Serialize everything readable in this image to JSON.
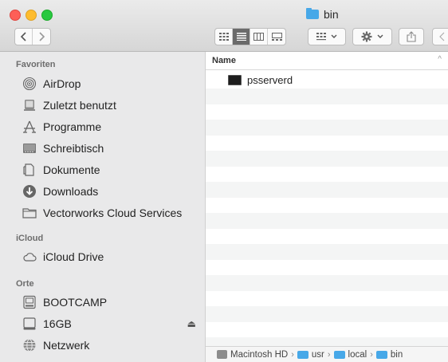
{
  "window": {
    "title": "bin"
  },
  "toolbar": {
    "back_icon": "chevron-left-icon",
    "forward_icon": "chevron-right-icon",
    "view_modes": [
      "icon-view",
      "list-view",
      "column-view",
      "gallery-view"
    ],
    "active_view": "list-view"
  },
  "sidebar": {
    "favorites_header": "Favoriten",
    "favorites": [
      {
        "label": "AirDrop",
        "icon": "airdrop-icon"
      },
      {
        "label": "Zuletzt benutzt",
        "icon": "recents-icon"
      },
      {
        "label": "Programme",
        "icon": "applications-icon"
      },
      {
        "label": "Schreibtisch",
        "icon": "desktop-icon"
      },
      {
        "label": "Dokumente",
        "icon": "documents-icon"
      },
      {
        "label": "Downloads",
        "icon": "downloads-icon"
      },
      {
        "label": "Vectorworks Cloud Services",
        "icon": "folder-icon"
      }
    ],
    "icloud_header": "iCloud",
    "icloud": [
      {
        "label": "iCloud Drive",
        "icon": "cloud-icon"
      }
    ],
    "locations_header": "Orte",
    "locations": [
      {
        "label": "BOOTCAMP",
        "icon": "disk-icon"
      },
      {
        "label": "16GB",
        "icon": "drive-icon",
        "eject": "⏏"
      },
      {
        "label": "Netzwerk",
        "icon": "network-icon"
      }
    ]
  },
  "list": {
    "column_name": "Name",
    "sort_indicator": "^",
    "files": [
      {
        "name": "psserverd",
        "icon": "terminal-exec-icon"
      }
    ]
  },
  "pathbar": {
    "segments": [
      "Macintosh HD",
      "usr",
      "local",
      "bin"
    ],
    "separator": "›"
  },
  "colors": {
    "folder": "#47a8e8",
    "sidebar_bg": "#e9e9ea",
    "close": "#fe5f57",
    "minimize": "#febc2e",
    "zoom": "#28c840"
  }
}
